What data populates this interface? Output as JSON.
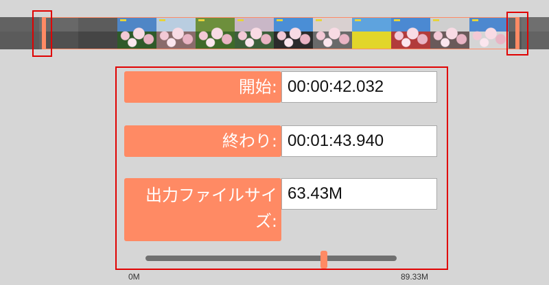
{
  "filmstrip": {
    "frames": [
      {
        "sky": "#6b6b6b",
        "ground": "#5a5a5a",
        "dim": true
      },
      {
        "sky": "#8a8a8a",
        "ground": "#6a6a6a",
        "dim": true
      },
      {
        "sky": "#7a7a7a",
        "ground": "#5c5c5c",
        "dim": true
      },
      {
        "sky": "#4f86c6",
        "ground": "#2f5a2a",
        "blossom": true
      },
      {
        "sky": "#b9cde0",
        "ground": "#8a6b6b",
        "blossom": true
      },
      {
        "sky": "#6d8f3c",
        "ground": "#3f6a2a",
        "blossom": true
      },
      {
        "sky": "#c9b7c7",
        "ground": "#3c5f3a",
        "blossom": true
      },
      {
        "sky": "#4a8ed6",
        "ground": "#2b2b2b",
        "blossom": true
      },
      {
        "sky": "#d9d0d0",
        "ground": "#6a6a6a",
        "blossom": true
      },
      {
        "sky": "#5ea3de",
        "ground": "#e2d62a"
      },
      {
        "sky": "#4b89d2",
        "ground": "#b23b3b",
        "blossom": true
      },
      {
        "sky": "#cfcfcf",
        "ground": "#6a5a5a",
        "blossom": true
      },
      {
        "sky": "#4d88cf",
        "ground": "#d5d5d5",
        "blossom": true
      },
      {
        "sky": "#8b8b8b",
        "ground": "#6f6f6f",
        "dim": true
      }
    ]
  },
  "trim": {
    "start_label": "開始:",
    "start_value": "00:00:42.032",
    "end_label": "終わり:",
    "end_value": "00:01:43.940",
    "size_label": "出力ファイルサイズ:",
    "size_value": "63.43M"
  },
  "size_slider": {
    "min_label": "0M",
    "max_label": "89.33M",
    "value_fraction": 0.71
  },
  "colors": {
    "accent": "#ff8a64",
    "highlight": "#e00000",
    "background": "#d6d6d6"
  }
}
